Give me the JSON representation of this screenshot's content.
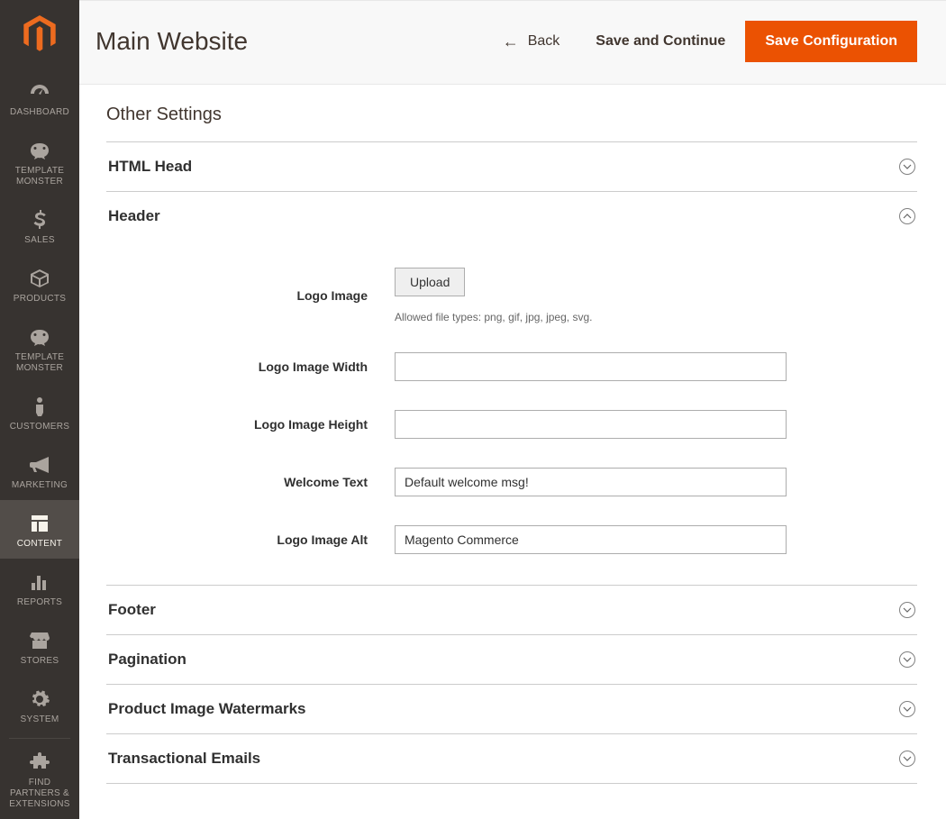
{
  "sidebar": {
    "items": [
      {
        "label": "DASHBOARD"
      },
      {
        "label": "TEMPLATE MONSTER"
      },
      {
        "label": "SALES"
      },
      {
        "label": "PRODUCTS"
      },
      {
        "label": "TEMPLATE MONSTER"
      },
      {
        "label": "CUSTOMERS"
      },
      {
        "label": "MARKETING"
      },
      {
        "label": "CONTENT"
      },
      {
        "label": "REPORTS"
      },
      {
        "label": "STORES"
      },
      {
        "label": "SYSTEM"
      },
      {
        "label": "FIND PARTNERS & EXTENSIONS"
      }
    ]
  },
  "header": {
    "title": "Main Website",
    "back_label": "Back",
    "save_continue_label": "Save and Continue",
    "save_config_label": "Save Configuration"
  },
  "content": {
    "other_settings_title": "Other Settings",
    "sections": {
      "html_head": {
        "title": "HTML Head"
      },
      "header": {
        "title": "Header",
        "fields": {
          "logo_image": {
            "label": "Logo Image",
            "upload_label": "Upload",
            "hint": "Allowed file types: png, gif, jpg, jpeg, svg."
          },
          "logo_width": {
            "label": "Logo Image Width",
            "value": ""
          },
          "logo_height": {
            "label": "Logo Image Height",
            "value": ""
          },
          "welcome_text": {
            "label": "Welcome Text",
            "value": "Default welcome msg!"
          },
          "logo_alt": {
            "label": "Logo Image Alt",
            "value": "Magento Commerce"
          }
        }
      },
      "footer": {
        "title": "Footer"
      },
      "pagination": {
        "title": "Pagination"
      },
      "watermarks": {
        "title": "Product Image Watermarks"
      },
      "trans_emails": {
        "title": "Transactional Emails"
      }
    }
  },
  "colors": {
    "accent": "#eb5202",
    "sidebar_bg": "#373330"
  }
}
